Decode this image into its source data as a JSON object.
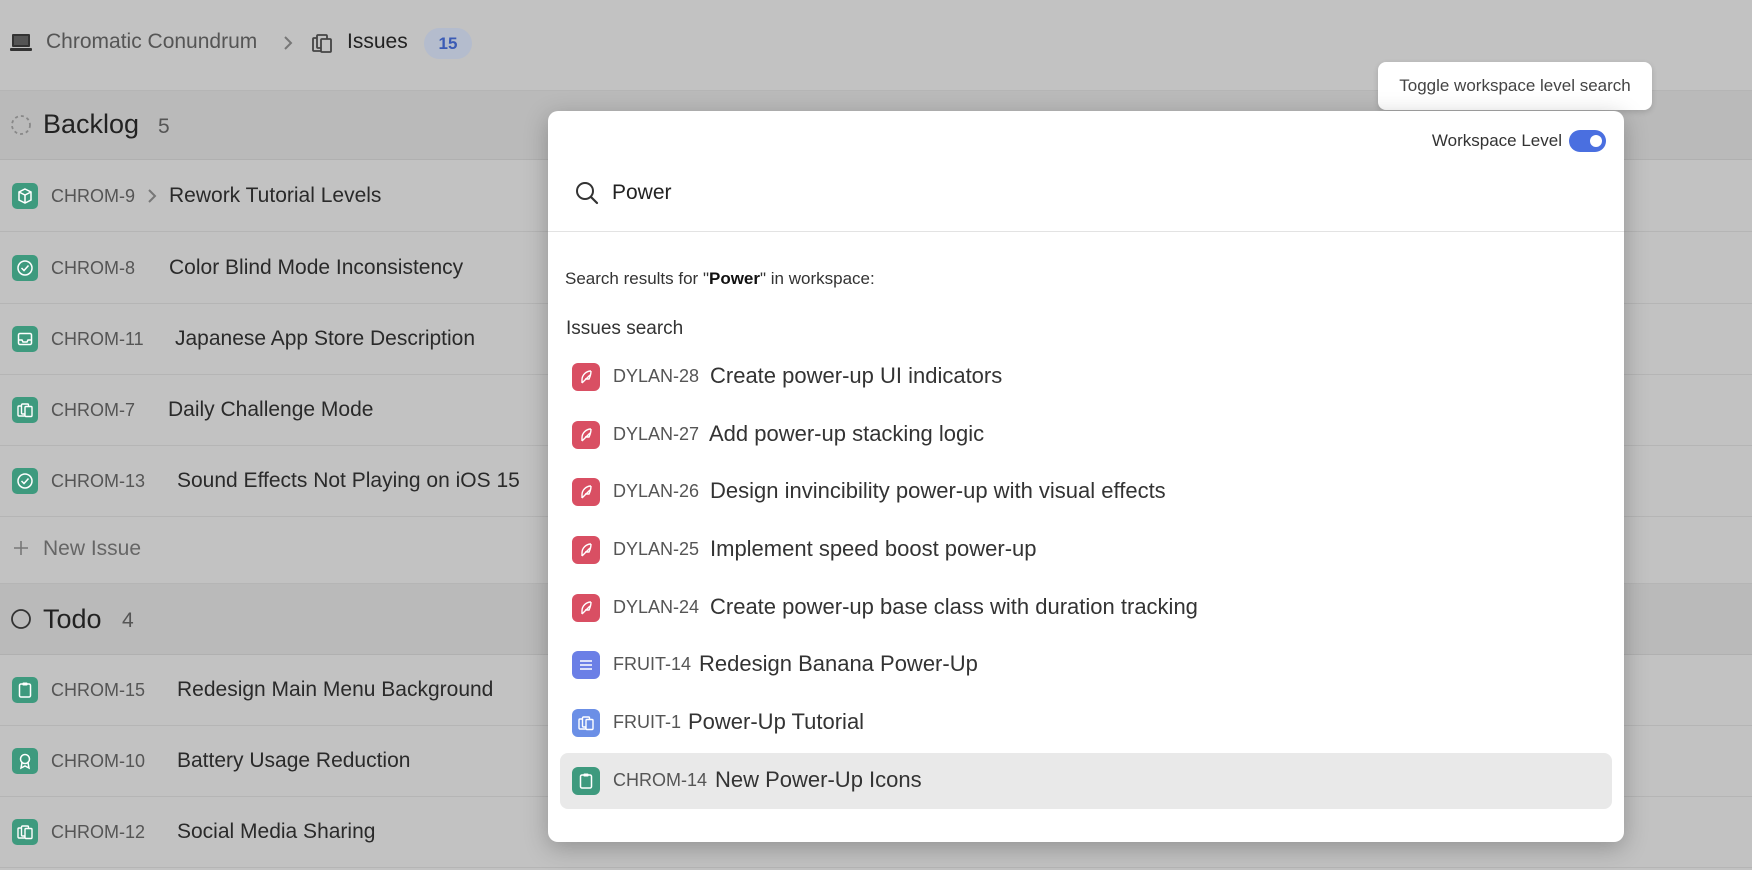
{
  "breadcrumb": {
    "workspace": "Chromatic Conundrum",
    "page": "Issues",
    "count": "15"
  },
  "groups": {
    "backlog": {
      "title": "Backlog",
      "count": "5",
      "rows": [
        {
          "id": "CHROM-9",
          "title": "Rework Tutorial Levels",
          "icon": "cube-icon"
        },
        {
          "id": "CHROM-8",
          "title": "Color Blind Mode Inconsistency",
          "icon": "check-circle-icon"
        },
        {
          "id": "CHROM-11",
          "title": "Japanese App Store Description",
          "icon": "inbox-icon"
        },
        {
          "id": "CHROM-7",
          "title": "Daily Challenge Mode",
          "icon": "stack-icon"
        },
        {
          "id": "CHROM-13",
          "title": "Sound Effects Not Playing on iOS 15",
          "icon": "check-circle-icon"
        }
      ],
      "new_issue": "New Issue"
    },
    "todo": {
      "title": "Todo",
      "count": "4",
      "rows": [
        {
          "id": "CHROM-15",
          "title": "Redesign Main Menu Background",
          "icon": "clipboard-icon"
        },
        {
          "id": "CHROM-10",
          "title": "Battery Usage Reduction",
          "icon": "award-icon"
        },
        {
          "id": "CHROM-12",
          "title": "Social Media Sharing",
          "icon": "stack-icon"
        }
      ]
    }
  },
  "tooltip": "Toggle workspace level search",
  "search": {
    "toggle_label": "Workspace Level",
    "toggle_on": true,
    "query": "Power",
    "results_prefix": "Search results for \"",
    "results_query": "Power",
    "results_suffix": "\" in workspace:",
    "section": "Issues search",
    "results": [
      {
        "id": "DYLAN-28",
        "title": "Create power-up UI indicators",
        "icon": "feather-icon",
        "color": "#d94f63"
      },
      {
        "id": "DYLAN-27",
        "title": "Add power-up stacking logic",
        "icon": "feather-icon",
        "color": "#d94f63"
      },
      {
        "id": "DYLAN-26",
        "title": "Design invincibility power-up with visual effects",
        "icon": "feather-icon",
        "color": "#d94f63"
      },
      {
        "id": "DYLAN-25",
        "title": "Implement speed boost power-up",
        "icon": "feather-icon",
        "color": "#d94f63"
      },
      {
        "id": "DYLAN-24",
        "title": "Create power-up base class with duration tracking",
        "icon": "feather-icon",
        "color": "#d94f63"
      },
      {
        "id": "FRUIT-14",
        "title": "Redesign Banana Power-Up",
        "icon": "list-icon",
        "color": "#6b7fe6"
      },
      {
        "id": "FRUIT-1",
        "title": "Power-Up Tutorial",
        "icon": "stack-icon",
        "color": "#6b8fe6"
      },
      {
        "id": "CHROM-14",
        "title": "New Power-Up Icons",
        "icon": "clipboard-icon",
        "color": "#3e9a7e"
      }
    ]
  },
  "colors": {
    "accent": "#4a6fe0",
    "chrom_green": "#3e9a7e",
    "dylan_red": "#d94f63",
    "fruit_blue": "#6b7fe6"
  }
}
